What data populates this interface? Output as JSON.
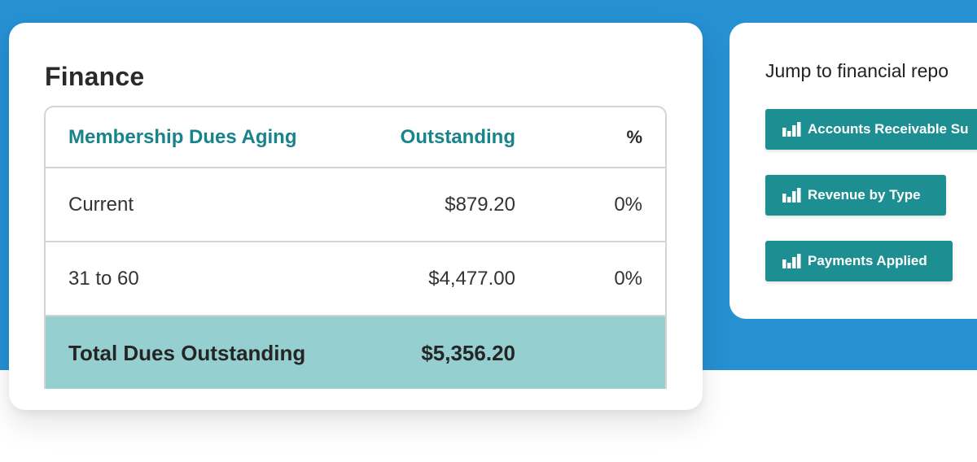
{
  "finance": {
    "title": "Finance",
    "table": {
      "headers": [
        "Membership Dues Aging",
        "Outstanding",
        "%"
      ],
      "rows": [
        {
          "label": "Current",
          "outstanding": "$879.20",
          "percent": "0%"
        },
        {
          "label": "31 to 60",
          "outstanding": "$4,477.00",
          "percent": "0%"
        }
      ],
      "total": {
        "label": "Total Dues Outstanding",
        "outstanding": "$5,356.20"
      }
    }
  },
  "reports": {
    "title": "Jump to financial repo",
    "buttons": [
      {
        "label": "Accounts Receivable Su",
        "icon": "bar-chart-icon"
      },
      {
        "label": "Revenue by Type",
        "icon": "bar-chart-icon"
      },
      {
        "label": "Payments Applied",
        "icon": "bar-chart-icon"
      }
    ]
  },
  "colors": {
    "background_band": "#2590d2",
    "accent_teal": "#1d8f93",
    "header_text_teal": "#17838a",
    "total_row": "#95cfcf"
  }
}
